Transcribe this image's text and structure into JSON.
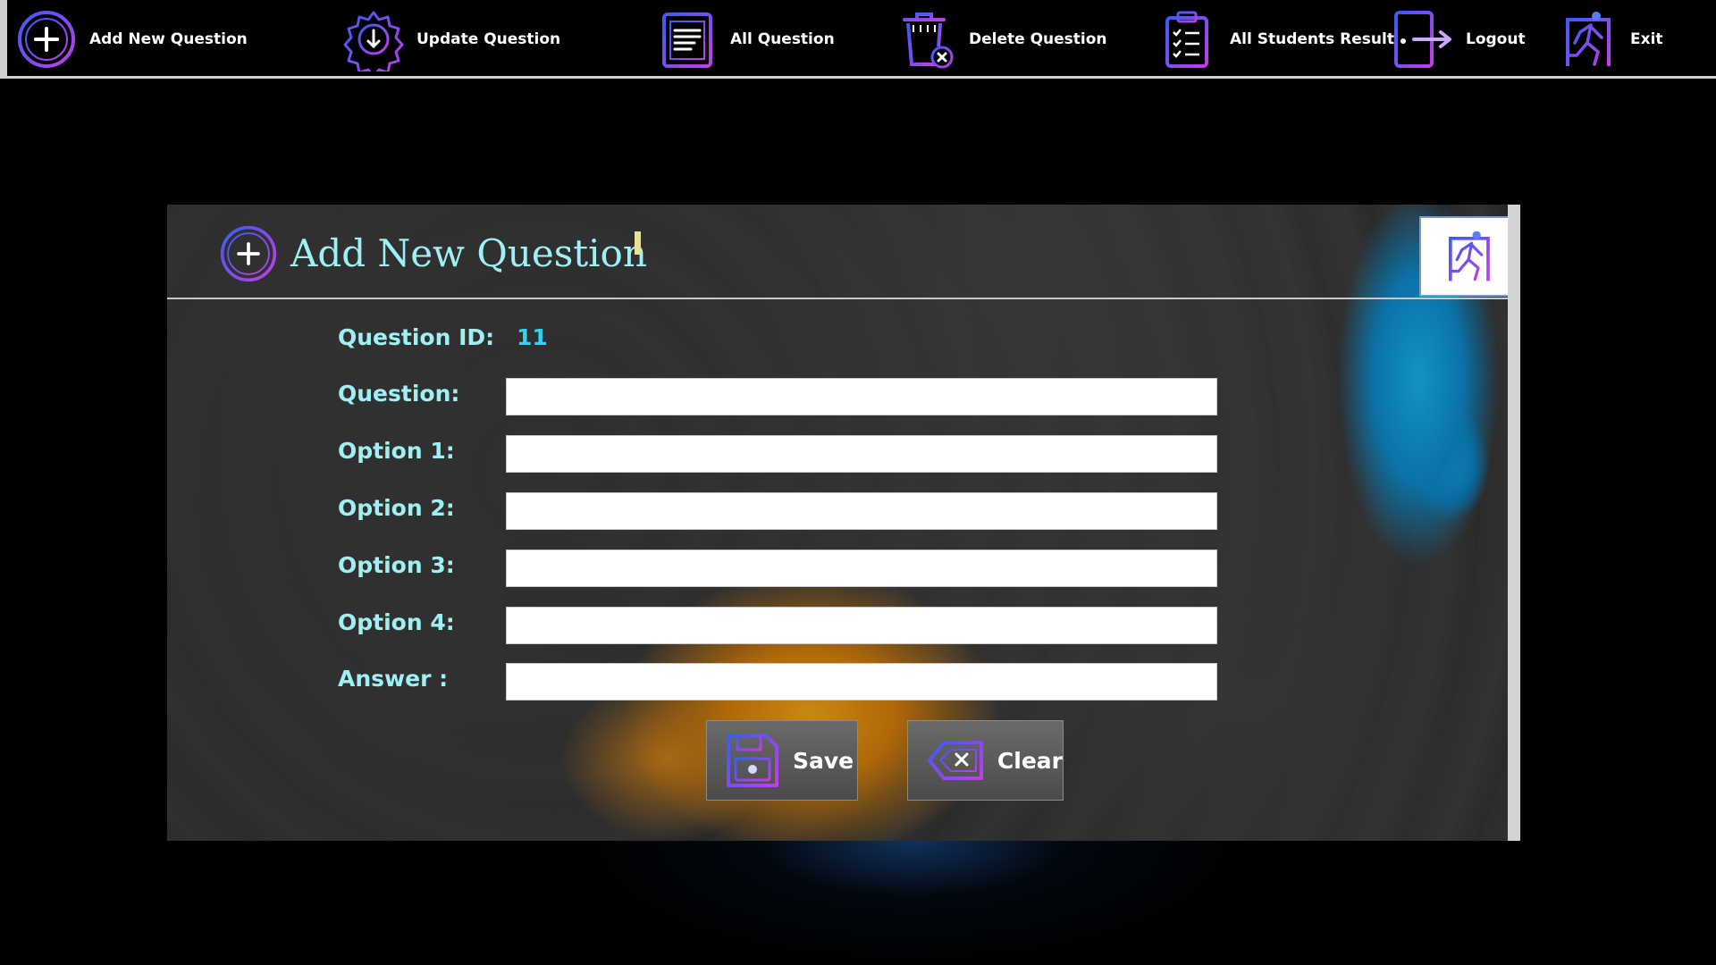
{
  "toolbar": {
    "items": [
      {
        "label": "Add New Question",
        "icon": "plus-circle-icon"
      },
      {
        "label": "Update Question",
        "icon": "gear-download-icon"
      },
      {
        "label": "All Question",
        "icon": "document-list-icon"
      },
      {
        "label": "Delete Question",
        "icon": "trash-delete-icon"
      },
      {
        "label": "All Students Result",
        "icon": "clipboard-checklist-icon"
      },
      {
        "label": "Logout",
        "icon": "door-exit-icon"
      },
      {
        "label": "Exit",
        "icon": "running-exit-icon"
      }
    ]
  },
  "panel": {
    "title": "Add New Question",
    "title_icon": "plus-circle-icon",
    "exit_icon": "running-exit-icon"
  },
  "form": {
    "question_id_label": "Question ID:",
    "question_id_value": "11",
    "fields": [
      {
        "label": "Question:",
        "value": ""
      },
      {
        "label": "Option 1:",
        "value": ""
      },
      {
        "label": "Option 2:",
        "value": ""
      },
      {
        "label": "Option 3:",
        "value": ""
      },
      {
        "label": "Option 4:",
        "value": ""
      },
      {
        "label": "Answer :",
        "value": ""
      }
    ]
  },
  "buttons": {
    "save_label": "Save",
    "save_icon": "floppy-disk-icon",
    "clear_label": "Clear",
    "clear_icon": "backspace-clear-icon"
  },
  "colors": {
    "label_cyan": "#9ff0f4",
    "id_value_cyan": "#31d3f2",
    "icon_gradient_start": "#3a5cf5",
    "icon_gradient_end": "#c23ee8"
  }
}
